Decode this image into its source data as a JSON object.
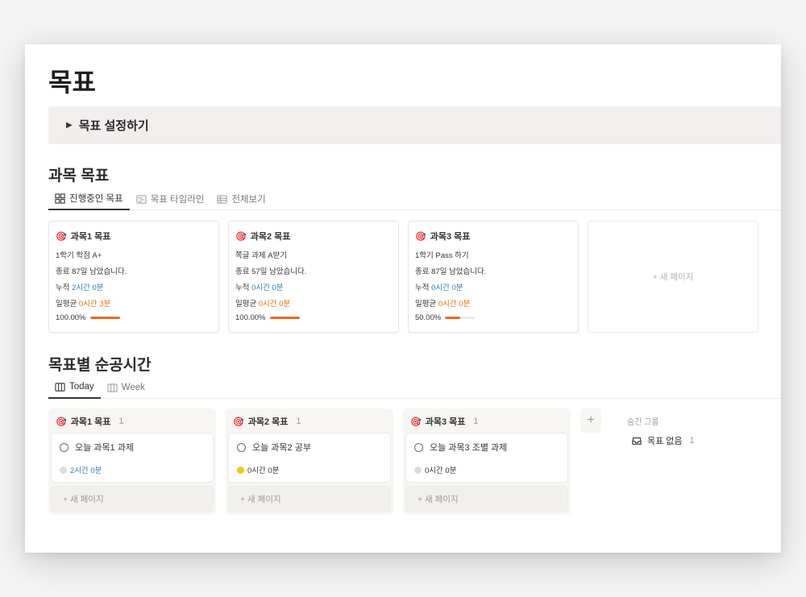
{
  "page": {
    "title": "목표"
  },
  "callout": {
    "label": "목표 설정하기"
  },
  "goals_section": {
    "title": "과목 목표",
    "tabs": [
      {
        "label": "진행중인 목표",
        "icon": "gallery-icon"
      },
      {
        "label": "목표 타임라인",
        "icon": "timeline-icon"
      },
      {
        "label": "전체보기",
        "icon": "table-icon"
      }
    ],
    "cards": [
      {
        "emoji": "🎯",
        "title": "과목1 목표",
        "goal": "1학기 학점 A+",
        "remaining": "종료 87일 남았습니다.",
        "total_label": "누적",
        "total_value": "2시간 0분",
        "avg_label": "일평균",
        "avg_value": "0시간 3분",
        "progress_text": "100.00%",
        "progress": 1.0
      },
      {
        "emoji": "🎯",
        "title": "과목2 목표",
        "goal": "쪽글 과제 A받기",
        "remaining": "종료 57일 남았습니다.",
        "total_label": "누적",
        "total_value": "0시간 0분",
        "avg_label": "일평균",
        "avg_value": "0시간 0분",
        "progress_text": "100.00%",
        "progress": 1.0
      },
      {
        "emoji": "🎯",
        "title": "과목3 목표",
        "goal": "1학기 Pass 하기",
        "remaining": "종료 87일 남았습니다.",
        "total_label": "누적",
        "total_value": "0시간 0분",
        "avg_label": "일평균",
        "avg_value": "0시간 0분",
        "progress_text": "50.00%",
        "progress": 0.5
      }
    ],
    "new_page_label": "+ 새 페이지"
  },
  "study_section": {
    "title": "목표별 순공시간",
    "tabs": [
      {
        "label": "Today",
        "icon": "board-icon"
      },
      {
        "label": "Week",
        "icon": "board-icon"
      }
    ],
    "columns": [
      {
        "emoji": "🎯",
        "title": "과목1 목표",
        "count": "1",
        "task": "오늘 과목1  과제",
        "time": "2시간 0분",
        "time_color": "blue",
        "dot": "#dcdcdc"
      },
      {
        "emoji": "🎯",
        "title": "과목2 목표",
        "count": "1",
        "task": "오늘 과목2 공부",
        "time": "0시간 0분",
        "time_color": "default",
        "dot": "#f5c518"
      },
      {
        "emoji": "🎯",
        "title": "과목3 목표",
        "count": "1",
        "task": "오늘 과목3 조별 과제",
        "time": "0시간 0분",
        "time_color": "default",
        "dot": "#dcdcdc"
      }
    ],
    "add_label": "+ 새 페이지",
    "add_group": "+",
    "hidden_label": "숨긴 그룹",
    "hidden_group": {
      "label": "목표 없음",
      "count": "1"
    }
  },
  "colors": {
    "accent_orange": "#e16f24",
    "blue_text": "#337ea9",
    "callout_bg": "#f3eeee"
  }
}
